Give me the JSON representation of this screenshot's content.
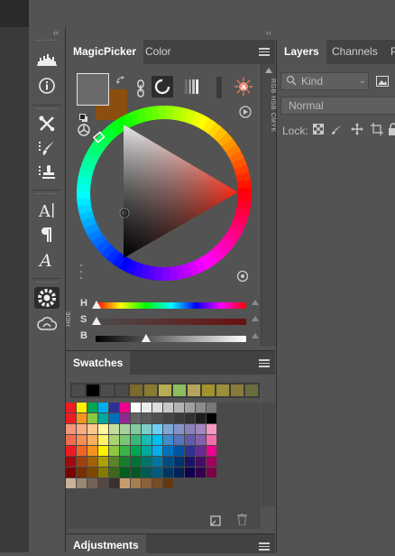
{
  "toolbar": {
    "collapse_left": "‹‹",
    "collapse_right": "‹‹",
    "tools": [
      {
        "name": "histogram-icon"
      },
      {
        "name": "info-icon"
      },
      {
        "name": "tool-presets-icon"
      },
      {
        "name": "brush-presets-icon"
      },
      {
        "name": "clone-source-icon"
      },
      {
        "name": "character-icon"
      },
      {
        "name": "paragraph-icon"
      },
      {
        "name": "glyphs-icon"
      },
      {
        "name": "magicpicker-icon"
      },
      {
        "name": "creative-cloud-libraries-icon"
      }
    ]
  },
  "picker": {
    "tabs": [
      {
        "label": "MagicPicker",
        "active": true
      },
      {
        "label": "Color",
        "active": false
      }
    ],
    "side_tab_text": "RGB HSB CMYK",
    "hide_tab_text": "HIDE",
    "foreground_color": "#6a6a6a",
    "background_color": "#8b4e0e",
    "sliders": [
      {
        "label": "H",
        "value": 0.0
      },
      {
        "label": "S",
        "value": 0.0
      },
      {
        "label": "B",
        "value": 0.22
      }
    ]
  },
  "swatches": {
    "tab_label": "Swatches",
    "recent": [
      "#4b4b4b",
      "#000000",
      "#4d4d4d",
      "#4a4a4a",
      "#7a6a2d",
      "#8a7a30",
      "#b5ac53",
      "#8cbd5e",
      "#b4a55a",
      "#a3912e",
      "#9d8e3a",
      "#8a7a3a",
      "#6b6b40"
    ],
    "grid": [
      [
        "#ed1c24",
        "#fff200",
        "#00a651",
        "#00aeef",
        "#2e3192",
        "#ec008c",
        "#ffffff",
        "#ececec",
        "#dcdcdc",
        "#c8c8c8",
        "#b4b4b4",
        "#a0a0a0",
        "#8c8c8c",
        "#787878"
      ],
      [
        "#ed1c24",
        "#f7941d",
        "#8dc63f",
        "#00a99d",
        "#0072bc",
        "#92278f",
        "#646464",
        "#5a5a5a",
        "#505050",
        "#464646",
        "#3c3c3c",
        "#323232",
        "#1e1e1e",
        "#000000"
      ],
      [
        "#f7977a",
        "#fbad82",
        "#fdc68c",
        "#fff79a",
        "#c4df9b",
        "#a3d39c",
        "#82ca9d",
        "#7bcdc8",
        "#6ecff6",
        "#7ea7d8",
        "#8493ca",
        "#8882be",
        "#a187be",
        "#f49ac2"
      ],
      [
        "#f26c4f",
        "#f68e56",
        "#fbaf5c",
        "#fff467",
        "#acd372",
        "#7cc576",
        "#3bb878",
        "#1abbb4",
        "#00bff3",
        "#438ccb",
        "#5574b9",
        "#605ca9",
        "#855fa8",
        "#f06ea9"
      ],
      [
        "#ed1c24",
        "#f26522",
        "#f7941d",
        "#fff200",
        "#8dc63f",
        "#39b54a",
        "#00a651",
        "#00a99d",
        "#00aeef",
        "#0072bc",
        "#0054a5",
        "#2e3192",
        "#662d91",
        "#ec008c"
      ],
      [
        "#9e0b0f",
        "#a0410d",
        "#a3620a",
        "#aba000",
        "#598527",
        "#1a7b30",
        "#007236",
        "#00746b",
        "#0076a3",
        "#004b80",
        "#003471",
        "#1b1464",
        "#440e62",
        "#9e005d"
      ],
      [
        "#790000",
        "#7b2e00",
        "#7d4900",
        "#827b00",
        "#406618",
        "#005e20",
        "#005826",
        "#005952",
        "#005b7f",
        "#003663",
        "#002157",
        "#0d004c",
        "#32004b",
        "#7b0046"
      ],
      [
        "#c7b299",
        "#998675",
        "#736357",
        "#534741",
        "#37302d",
        "#c69c6d",
        "#a67c52",
        "#8c6239",
        "#754c24",
        "#603913"
      ]
    ]
  },
  "adjustments": {
    "tab_label": "Adjustments"
  },
  "layers": {
    "tabs": [
      {
        "label": "Layers",
        "active": true
      },
      {
        "label": "Channels",
        "active": false
      },
      {
        "label": "P",
        "active": false
      }
    ],
    "filter_placeholder": "Kind",
    "blend_mode": "Normal",
    "lock_label": "Lock:"
  }
}
